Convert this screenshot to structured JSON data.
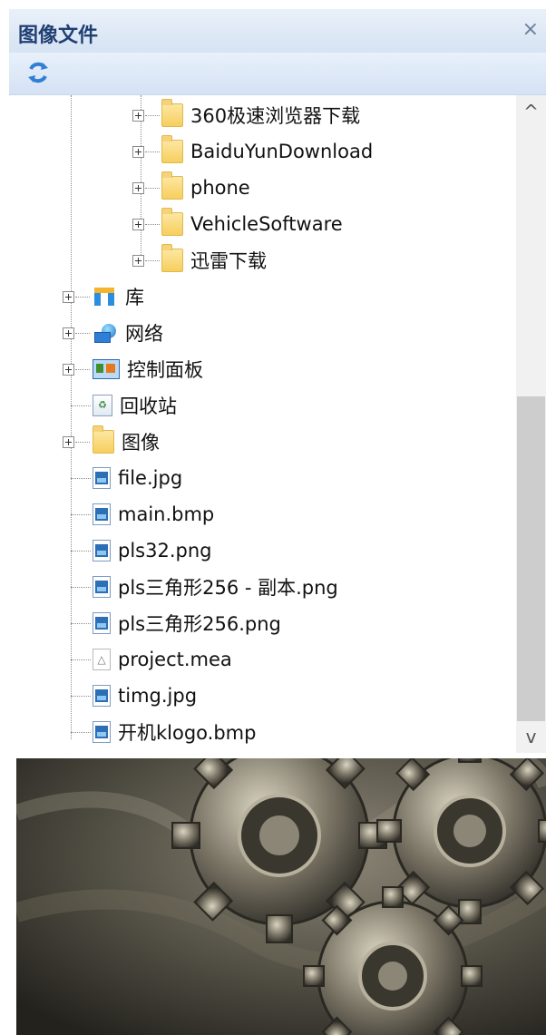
{
  "window": {
    "title": "图像文件",
    "close_symbol": "×"
  },
  "toolbar": {
    "refresh_icon": "refresh-icon"
  },
  "tree": {
    "subfolders": [
      "360极速浏览器下载",
      "BaiduYunDownload",
      "phone",
      "VehicleSoftware",
      "迅雷下载"
    ],
    "system_nodes": [
      {
        "label": "库",
        "icon": "library-icon"
      },
      {
        "label": "网络",
        "icon": "network-icon"
      },
      {
        "label": "控制面板",
        "icon": "control-panel-icon"
      },
      {
        "label": "回收站",
        "icon": "recycle-bin-icon"
      },
      {
        "label": "图像",
        "icon": "folder-icon"
      }
    ],
    "files": [
      {
        "label": "file.jpg",
        "icon": "image-file-icon"
      },
      {
        "label": "main.bmp",
        "icon": "image-file-icon"
      },
      {
        "label": "pls32.png",
        "icon": "image-file-icon"
      },
      {
        "label": "pls三角形256 - 副本.png",
        "icon": "image-file-icon"
      },
      {
        "label": "pls三角形256.png",
        "icon": "image-file-icon"
      },
      {
        "label": "project.mea",
        "icon": "mea-file-icon"
      },
      {
        "label": "timg.jpg",
        "icon": "image-file-icon"
      },
      {
        "label": "开机klogo.bmp",
        "icon": "image-file-icon"
      }
    ]
  },
  "scroll": {
    "up_symbol": "^",
    "down_symbol": "v"
  },
  "colors": {
    "title_text": "#1f3f73",
    "header_bg": "#dbe6f5",
    "folder_yellow": "#f6cf5d",
    "image_icon_blue": "#2d6fb5"
  }
}
